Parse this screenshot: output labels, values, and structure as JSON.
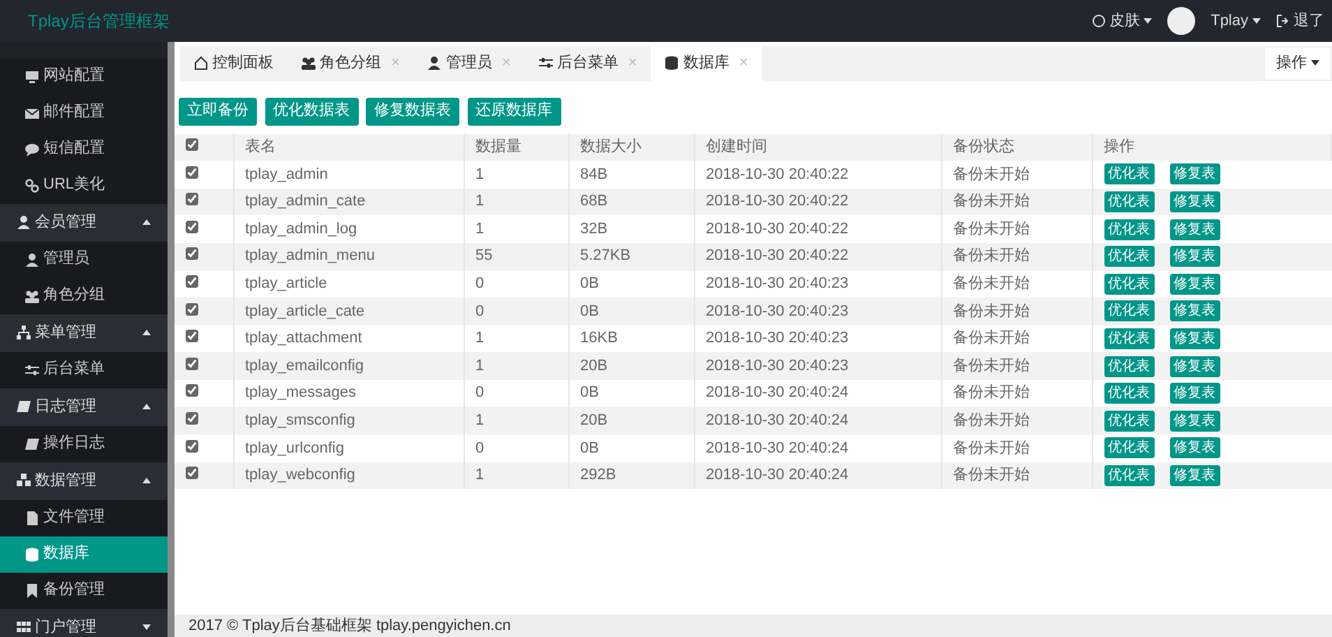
{
  "header": {
    "brand": "Tplay后台管理框架",
    "skin": "皮肤",
    "user": "Tplay",
    "logout": "退了"
  },
  "sidebar": {
    "entries": [
      {
        "kind": "item",
        "label": "网站配置",
        "selected": false
      },
      {
        "kind": "item",
        "label": "邮件配置",
        "selected": false
      },
      {
        "kind": "item",
        "label": "短信配置",
        "selected": false
      },
      {
        "kind": "item",
        "label": "URL美化",
        "selected": false
      },
      {
        "kind": "group",
        "label": "会员管理",
        "expanded": true,
        "children": [
          {
            "label": "管理员",
            "selected": false
          },
          {
            "label": "角色分组",
            "selected": false
          }
        ]
      },
      {
        "kind": "group",
        "label": "菜单管理",
        "expanded": true,
        "children": [
          {
            "label": "后台菜单",
            "selected": false
          }
        ]
      },
      {
        "kind": "group",
        "label": "日志管理",
        "expanded": true,
        "children": [
          {
            "label": "操作日志",
            "selected": false
          }
        ]
      },
      {
        "kind": "group",
        "label": "数据管理",
        "expanded": true,
        "children": [
          {
            "label": "文件管理",
            "selected": false
          },
          {
            "label": "数据库",
            "selected": true
          },
          {
            "label": "备份管理",
            "selected": false
          }
        ]
      },
      {
        "kind": "group",
        "label": "门户管理",
        "expanded": false
      }
    ]
  },
  "tabs": [
    {
      "label": "控制面板",
      "selected": false
    },
    {
      "label": "角色分组",
      "close": "×",
      "selected": false
    },
    {
      "label": "管理员",
      "close": "×",
      "selected": false
    },
    {
      "label": "后台菜单",
      "close": "×",
      "selected": false
    },
    {
      "label": "数据库",
      "close": "×",
      "selected": true
    }
  ],
  "tab_menu": "操作",
  "toolbar": [
    "立即备份",
    "优化数据表",
    "修复数据表",
    "还原数据库"
  ],
  "table": {
    "all_checked": true,
    "columns": [
      "表名",
      "数据量",
      "数据大小",
      "创建时间",
      "备份状态",
      "操作"
    ],
    "rows": [
      {
        "checked": true,
        "cells": [
          "tplay_admin",
          "1",
          "84B",
          "2018-10-30 20:40:22",
          "备份未开始"
        ],
        "actions": [
          "优化表",
          "修复表"
        ]
      },
      {
        "checked": true,
        "cells": [
          "tplay_admin_cate",
          "1",
          "68B",
          "2018-10-30 20:40:22",
          "备份未开始"
        ],
        "actions": [
          "优化表",
          "修复表"
        ]
      },
      {
        "checked": true,
        "cells": [
          "tplay_admin_log",
          "1",
          "32B",
          "2018-10-30 20:40:22",
          "备份未开始"
        ],
        "actions": [
          "优化表",
          "修复表"
        ]
      },
      {
        "checked": true,
        "cells": [
          "tplay_admin_menu",
          "55",
          "5.27KB",
          "2018-10-30 20:40:22",
          "备份未开始"
        ],
        "actions": [
          "优化表",
          "修复表"
        ]
      },
      {
        "checked": true,
        "cells": [
          "tplay_article",
          "0",
          "0B",
          "2018-10-30 20:40:23",
          "备份未开始"
        ],
        "actions": [
          "优化表",
          "修复表"
        ]
      },
      {
        "checked": true,
        "cells": [
          "tplay_article_cate",
          "0",
          "0B",
          "2018-10-30 20:40:23",
          "备份未开始"
        ],
        "actions": [
          "优化表",
          "修复表"
        ]
      },
      {
        "checked": true,
        "cells": [
          "tplay_attachment",
          "1",
          "16KB",
          "2018-10-30 20:40:23",
          "备份未开始"
        ],
        "actions": [
          "优化表",
          "修复表"
        ]
      },
      {
        "checked": true,
        "cells": [
          "tplay_emailconfig",
          "1",
          "20B",
          "2018-10-30 20:40:23",
          "备份未开始"
        ],
        "actions": [
          "优化表",
          "修复表"
        ]
      },
      {
        "checked": true,
        "cells": [
          "tplay_messages",
          "0",
          "0B",
          "2018-10-30 20:40:24",
          "备份未开始"
        ],
        "actions": [
          "优化表",
          "修复表"
        ]
      },
      {
        "checked": true,
        "cells": [
          "tplay_smsconfig",
          "1",
          "20B",
          "2018-10-30 20:40:24",
          "备份未开始"
        ],
        "actions": [
          "优化表",
          "修复表"
        ]
      },
      {
        "checked": true,
        "cells": [
          "tplay_urlconfig",
          "0",
          "0B",
          "2018-10-30 20:40:24",
          "备份未开始"
        ],
        "actions": [
          "优化表",
          "修复表"
        ]
      },
      {
        "checked": true,
        "cells": [
          "tplay_webconfig",
          "1",
          "292B",
          "2018-10-30 20:40:24",
          "备份未开始"
        ],
        "actions": [
          "优化表",
          "修复表"
        ]
      }
    ]
  },
  "footer": "2017 © Tplay后台基础框架 tplay.pengyichen.cn"
}
